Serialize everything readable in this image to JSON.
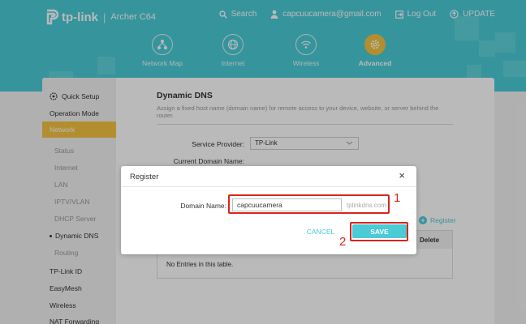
{
  "header": {
    "brand": "tp-link",
    "model": "Archer C64",
    "search_label": "Search",
    "account_email": "capcuucamera@gmail.com",
    "logout_label": "Log Out",
    "update_label": "UPDATE"
  },
  "nav": {
    "items": [
      {
        "label": "Network Map",
        "icon": "network-map-icon"
      },
      {
        "label": "Internet",
        "icon": "globe-icon"
      },
      {
        "label": "Wireless",
        "icon": "wifi-icon"
      },
      {
        "label": "Advanced",
        "icon": "gear-icon",
        "active": true
      }
    ]
  },
  "sidebar": {
    "items": [
      {
        "label": "Quick Setup"
      },
      {
        "label": "Operation Mode"
      },
      {
        "label": "Network",
        "active": true
      },
      {
        "label": "Status"
      },
      {
        "label": "Internet"
      },
      {
        "label": "LAN"
      },
      {
        "label": "IPTV/VLAN"
      },
      {
        "label": "DHCP Server"
      },
      {
        "label": "Dynamic DNS",
        "current": true
      },
      {
        "label": "Routing"
      },
      {
        "label": "TP-Link ID"
      },
      {
        "label": "EasyMesh"
      },
      {
        "label": "Wireless"
      },
      {
        "label": "NAT Forwarding"
      }
    ]
  },
  "page": {
    "title": "Dynamic DNS",
    "description": "Assign a fixed host name (domain name) for remote access to your device, website, or server behind the router.",
    "service_provider_label": "Service Provider:",
    "service_provider_value": "TP-Link",
    "current_domain_label": "Current Domain Name:",
    "register_label": "Register",
    "table_header_delete": "Delete",
    "empty_text": "No Entries in this table."
  },
  "dialog": {
    "title": "Register",
    "close_glyph": "×",
    "domain_label": "Domain Name:",
    "domain_value": "capcuucamera",
    "domain_suffix": "tplinkdns.com",
    "cancel_label": "CANCEL",
    "save_label": "SAVE"
  },
  "annotations": {
    "step1": "1",
    "step2": "2"
  },
  "colors": {
    "brand_teal": "#4acbd6",
    "accent_yellow": "#f6c342",
    "annotation_red": "#d9251c"
  }
}
